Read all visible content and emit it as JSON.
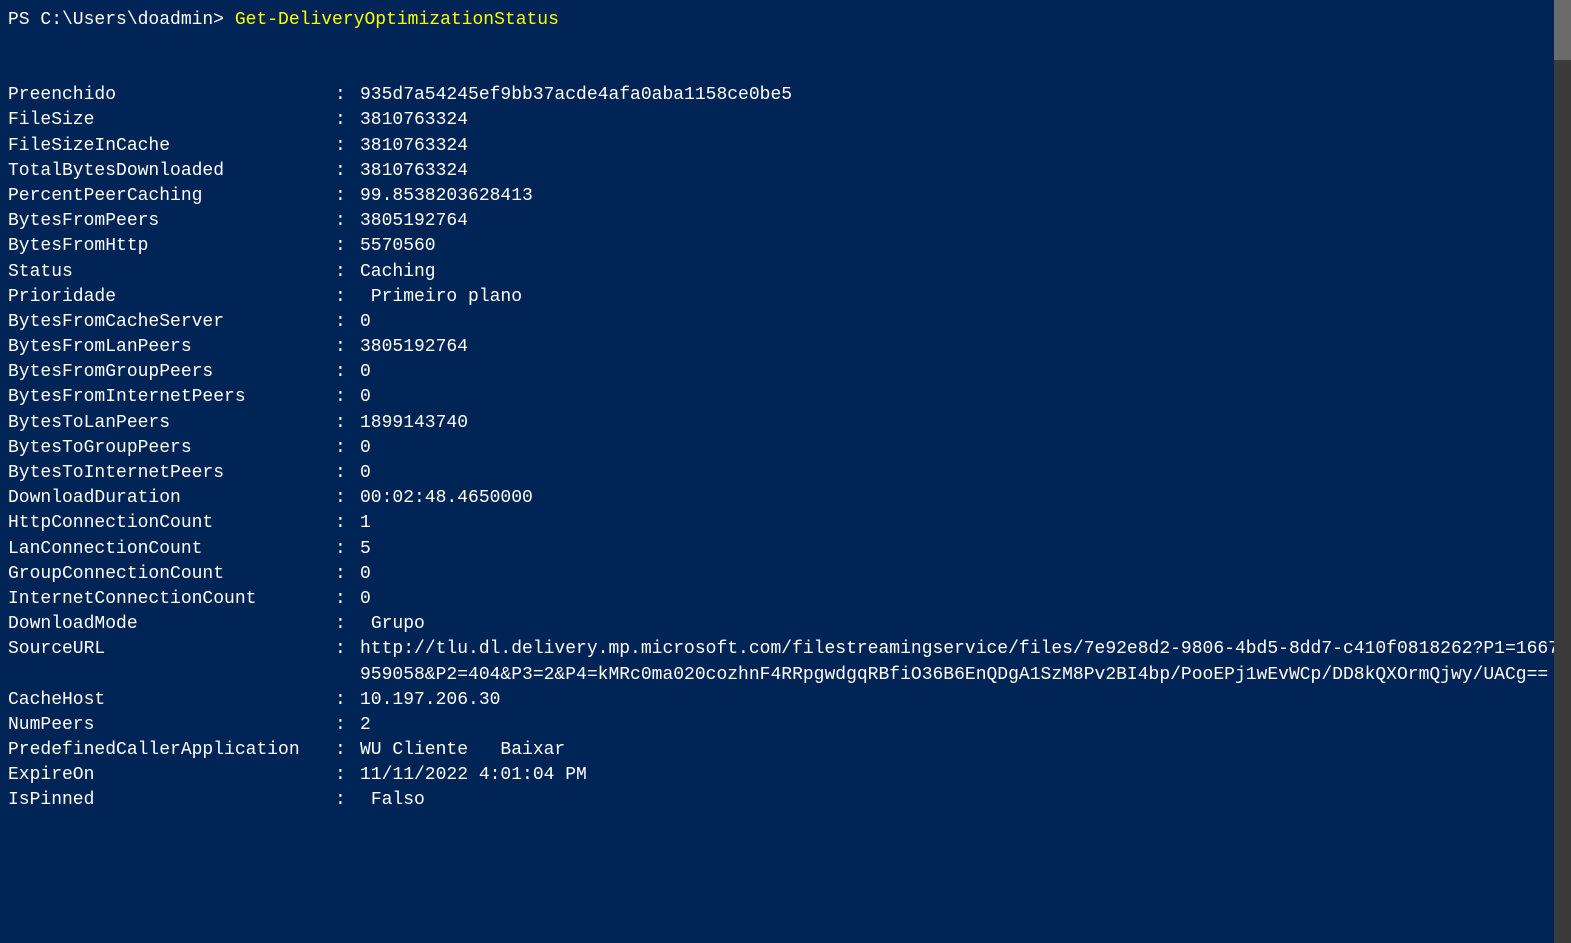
{
  "prompt": {
    "prefix": "PS C:\\Users\\doadmin> ",
    "command": "Get-DeliveryOptimizationStatus"
  },
  "rows": [
    {
      "key": "Preenchido",
      "value": "935d7a54245ef9bb37acde4afa0aba1158ce0be5"
    },
    {
      "key": "FileSize",
      "value": "3810763324"
    },
    {
      "key": "FileSizeInCache",
      "value": "3810763324"
    },
    {
      "key": "TotalBytesDownloaded",
      "value": "3810763324"
    },
    {
      "key": "PercentPeerCaching",
      "value": "99.8538203628413"
    },
    {
      "key": "BytesFromPeers",
      "value": "3805192764"
    },
    {
      "key": "BytesFromHttp",
      "value": "5570560"
    },
    {
      "key": "Status",
      "value": "Caching"
    },
    {
      "key": "Prioridade",
      "value": " Primeiro plano"
    },
    {
      "key": "BytesFromCacheServer",
      "value": "0"
    },
    {
      "key": "BytesFromLanPeers",
      "value": "3805192764"
    },
    {
      "key": "BytesFromGroupPeers",
      "value": "0"
    },
    {
      "key": "BytesFromInternetPeers",
      "value": "0"
    },
    {
      "key": "BytesToLanPeers",
      "value": "1899143740"
    },
    {
      "key": "BytesToGroupPeers",
      "value": "0"
    },
    {
      "key": "BytesToInternetPeers",
      "value": "0"
    },
    {
      "key": "DownloadDuration",
      "value": "00:02:48.4650000"
    },
    {
      "key": "HttpConnectionCount",
      "value": "1"
    },
    {
      "key": "LanConnectionCount",
      "value": "5"
    },
    {
      "key": "GroupConnectionCount",
      "value": "0"
    },
    {
      "key": "InternetConnectionCount",
      "value": "0"
    },
    {
      "key": "DownloadMode",
      "value": " Grupo"
    },
    {
      "key": "SourceURL",
      "value": "http://tlu.dl.delivery.mp.microsoft.com/filestreamingservice/files/7e92e8d2-9806-4bd5-8dd7-c410f0818262?P1=1667959058&P2=404&P3=2&P4=kMRc0ma020cozhnF4RRpgwdgqRBfiO36B6EnQDgA1SzM8Pv2BI4bp/PooEPj1wEvWCp/DD8kQXOrmQjwy/UACg=="
    },
    {
      "key": "CacheHost",
      "value": "10.197.206.30"
    },
    {
      "key": "NumPeers",
      "value": "2"
    },
    {
      "key": "PredefinedCallerApplication",
      "value": "WU Cliente   Baixar"
    },
    {
      "key": "ExpireOn",
      "value": "11/11/2022 4:01:04 PM"
    },
    {
      "key": "IsPinned",
      "value": " Falso"
    }
  ]
}
